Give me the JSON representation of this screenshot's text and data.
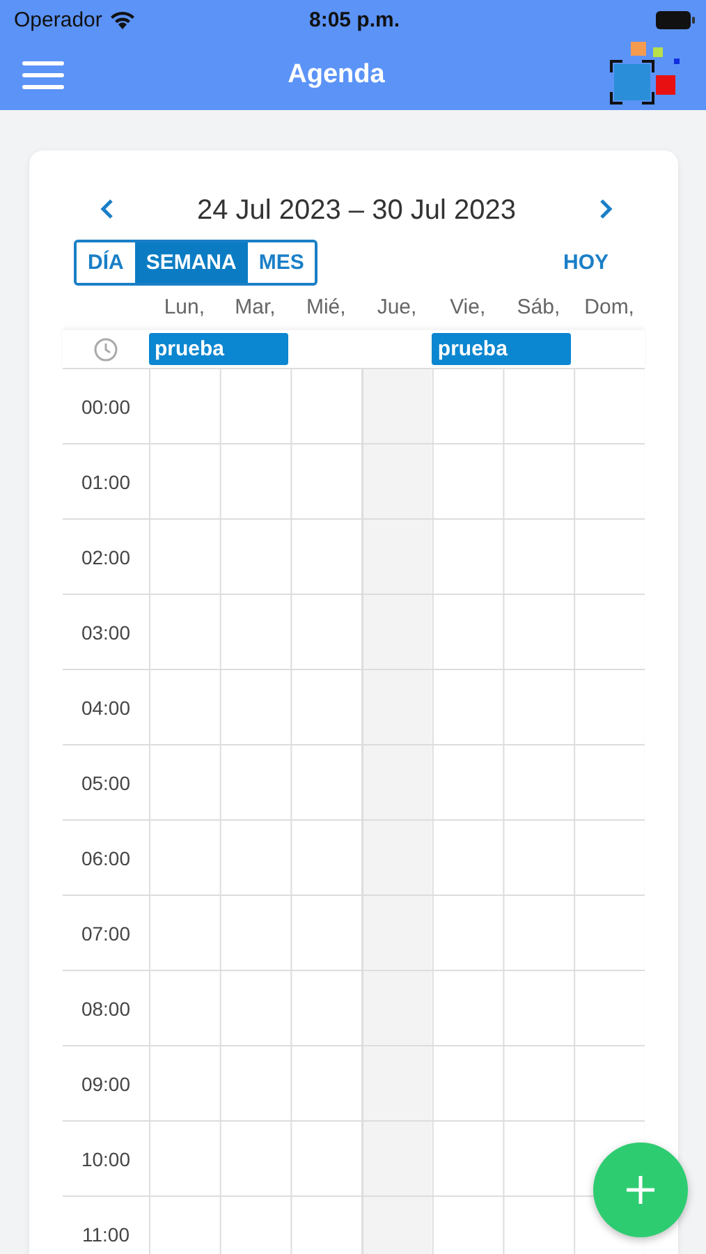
{
  "status_bar": {
    "carrier": "Operador",
    "time": "8:05 p.m."
  },
  "header": {
    "title": "Agenda"
  },
  "calendar": {
    "range": "24 Jul 2023 – 30 Jul 2023",
    "views": [
      {
        "label": "DÍA",
        "selected": false
      },
      {
        "label": "SEMANA",
        "selected": true
      },
      {
        "label": "MES",
        "selected": false
      }
    ],
    "today_button": "HOY",
    "days": [
      {
        "label": "Lun,",
        "today": false,
        "all_day_event": "prueba"
      },
      {
        "label": "Mar,",
        "today": false
      },
      {
        "label": "Mié,",
        "today": false
      },
      {
        "label": "Jue,",
        "today": true
      },
      {
        "label": "Vie,",
        "today": false,
        "all_day_event": "prueba"
      },
      {
        "label": "Sáb,",
        "today": false
      },
      {
        "label": "Dom,",
        "today": false
      }
    ],
    "hours": [
      "00:00",
      "01:00",
      "02:00",
      "03:00",
      "04:00",
      "05:00",
      "06:00",
      "07:00",
      "08:00",
      "09:00",
      "10:00",
      "11:00"
    ]
  }
}
